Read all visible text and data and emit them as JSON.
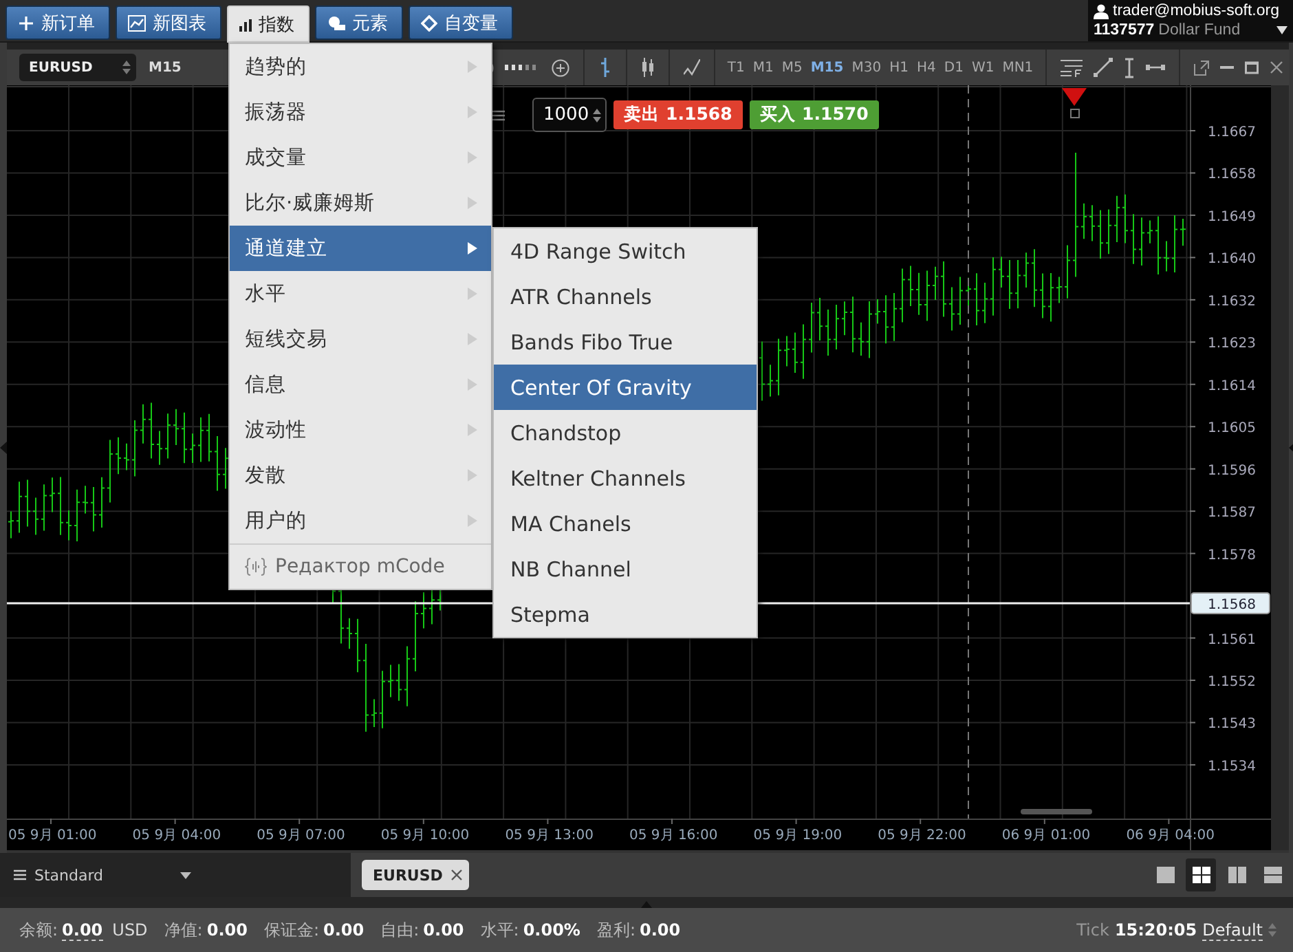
{
  "toolbar": [
    {
      "label": "新订单",
      "kind": "plus",
      "selected": false
    },
    {
      "label": "新图表",
      "kind": "chart",
      "selected": false
    },
    {
      "label": "指数",
      "kind": "bars",
      "selected": true
    },
    {
      "label": "元素",
      "kind": "shapes",
      "selected": false
    },
    {
      "label": "自变量",
      "kind": "diamond",
      "selected": false
    }
  ],
  "account": {
    "email": "trader@mobius-soft.org",
    "number": "1137577",
    "name": "Dollar Fund"
  },
  "chart": {
    "symbol": "EURUSD",
    "period": "M15",
    "timeframes": [
      {
        "label": "T1",
        "selected": false
      },
      {
        "label": "M1",
        "selected": false
      },
      {
        "label": "M5",
        "selected": false
      },
      {
        "label": "M15",
        "selected": true
      },
      {
        "label": "M30",
        "selected": false
      },
      {
        "label": "H1",
        "selected": false
      },
      {
        "label": "H4",
        "selected": false
      },
      {
        "label": "D1",
        "selected": false
      },
      {
        "label": "W1",
        "selected": false
      },
      {
        "label": "MN1",
        "selected": false
      }
    ],
    "order": {
      "volume": "1000",
      "sell": {
        "label": "卖出",
        "price": "1.1568"
      },
      "buy": {
        "label": "买入",
        "price": "1.1570"
      }
    },
    "price_axis": [
      "1.1667",
      "1.1658",
      "1.1649",
      "1.1640",
      "1.1632",
      "1.1623",
      "1.1614",
      "1.1605",
      "1.1596",
      "1.1587",
      "1.1578",
      "1.1561",
      "1.1552",
      "1.1543",
      "1.1534"
    ],
    "current_price": "1.1568",
    "time_axis": [
      "05 9月 01:00",
      "05 9月 04:00",
      "05 9月 07:00",
      "05 9月 10:00",
      "05 9月 13:00",
      "05 9月 16:00",
      "05 9月 19:00",
      "05 9月 22:00",
      "06 9月 01:00",
      "06 9月 04:00"
    ]
  },
  "menu": [
    {
      "label": "趋势的",
      "kind": "submenu",
      "selected": false
    },
    {
      "label": "振荡器",
      "kind": "submenu",
      "selected": false
    },
    {
      "label": "成交量",
      "kind": "submenu",
      "selected": false
    },
    {
      "label": "比尔·威廉姆斯",
      "kind": "submenu",
      "selected": false
    },
    {
      "label": "通道建立",
      "kind": "submenu",
      "selected": true
    },
    {
      "label": "水平",
      "kind": "submenu",
      "selected": false
    },
    {
      "label": "短线交易",
      "kind": "submenu",
      "selected": false
    },
    {
      "label": "信息",
      "kind": "submenu",
      "selected": false
    },
    {
      "label": "波动性",
      "kind": "submenu",
      "selected": false
    },
    {
      "label": "发散",
      "kind": "submenu",
      "selected": false
    },
    {
      "label": "用户的",
      "kind": "submenu",
      "selected": false
    },
    {
      "label": "Редактор mCode",
      "kind": "editor",
      "selected": false
    }
  ],
  "submenu": [
    {
      "label": "4D Range Switch",
      "selected": false
    },
    {
      "label": "ATR Channels",
      "selected": false
    },
    {
      "label": "Bands Fibo True",
      "selected": false
    },
    {
      "label": "Center Of Gravity",
      "selected": true
    },
    {
      "label": "Chandstop",
      "selected": false
    },
    {
      "label": "Keltner Channels",
      "selected": false
    },
    {
      "label": "MA Chanels",
      "selected": false
    },
    {
      "label": "NB Channel",
      "selected": false
    },
    {
      "label": "Stepma",
      "selected": false
    }
  ],
  "workspace": {
    "label": "Standard"
  },
  "tabs": [
    {
      "label": "EURUSD"
    }
  ],
  "layouts": [
    {
      "kind": "single",
      "selected": false
    },
    {
      "kind": "grid",
      "selected": true
    },
    {
      "kind": "columns",
      "selected": false
    },
    {
      "kind": "rows",
      "selected": false
    }
  ],
  "status": {
    "items": [
      {
        "label": "余额:",
        "value": "0.00",
        "unit": "USD"
      },
      {
        "label": "净值:",
        "value": "0.00"
      },
      {
        "label": "保证金:",
        "value": "0.00"
      },
      {
        "label": "自由:",
        "value": "0.00"
      },
      {
        "label": "水平:",
        "value": "0.00%"
      },
      {
        "label": "盈利:",
        "value": "0.00"
      }
    ],
    "tick_label": "Tick",
    "time": "15:20:05",
    "profile": "Default"
  }
}
